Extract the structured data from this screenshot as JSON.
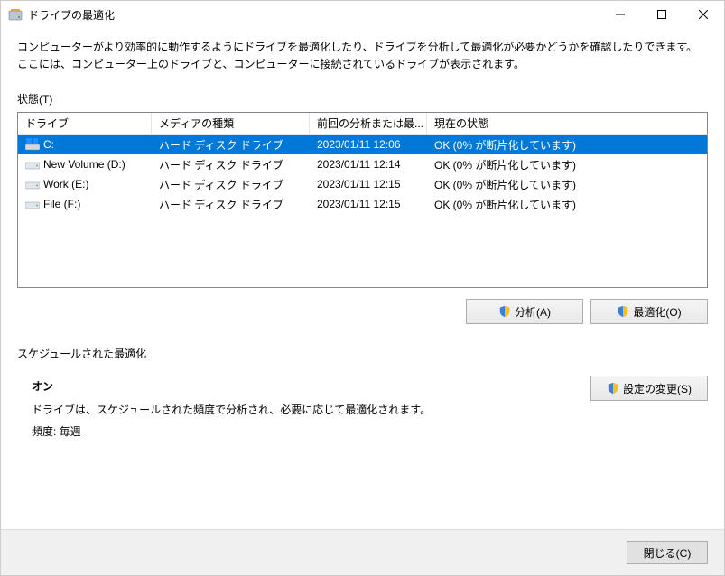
{
  "window": {
    "title": "ドライブの最適化"
  },
  "description": "コンピューターがより効率的に動作するようにドライブを最適化したり、ドライブを分析して最適化が必要かどうかを確認したりできます。\nここには、コンピューター上のドライブと、コンピューターに接続されているドライブが表示されます。",
  "status_label": "状態(T)",
  "columns": {
    "drive": "ドライブ",
    "media": "メディアの種類",
    "last": "前回の分析または最...",
    "status": "現在の状態"
  },
  "rows": [
    {
      "drive": "C:",
      "media": "ハード ディスク ドライブ",
      "last": "2023/01/11 12:06",
      "status": "OK (0% が断片化しています)",
      "selected": true,
      "drive_type": "system"
    },
    {
      "drive": "New Volume (D:)",
      "media": "ハード ディスク ドライブ",
      "last": "2023/01/11 12:14",
      "status": "OK (0% が断片化しています)",
      "selected": false,
      "drive_type": "hdd"
    },
    {
      "drive": "Work (E:)",
      "media": "ハード ディスク ドライブ",
      "last": "2023/01/11 12:15",
      "status": "OK (0% が断片化しています)",
      "selected": false,
      "drive_type": "hdd"
    },
    {
      "drive": "File (F:)",
      "media": "ハード ディスク ドライブ",
      "last": "2023/01/11 12:15",
      "status": "OK (0% が断片化しています)",
      "selected": false,
      "drive_type": "hdd"
    }
  ],
  "buttons": {
    "analyze": "分析(A)",
    "optimize": "最適化(O)",
    "change_settings": "設定の変更(S)",
    "close": "閉じる(C)"
  },
  "schedule": {
    "heading": "スケジュールされた最適化",
    "state": "オン",
    "desc": "ドライブは、スケジュールされた頻度で分析され、必要に応じて最適化されます。",
    "frequency": "頻度: 毎週"
  }
}
